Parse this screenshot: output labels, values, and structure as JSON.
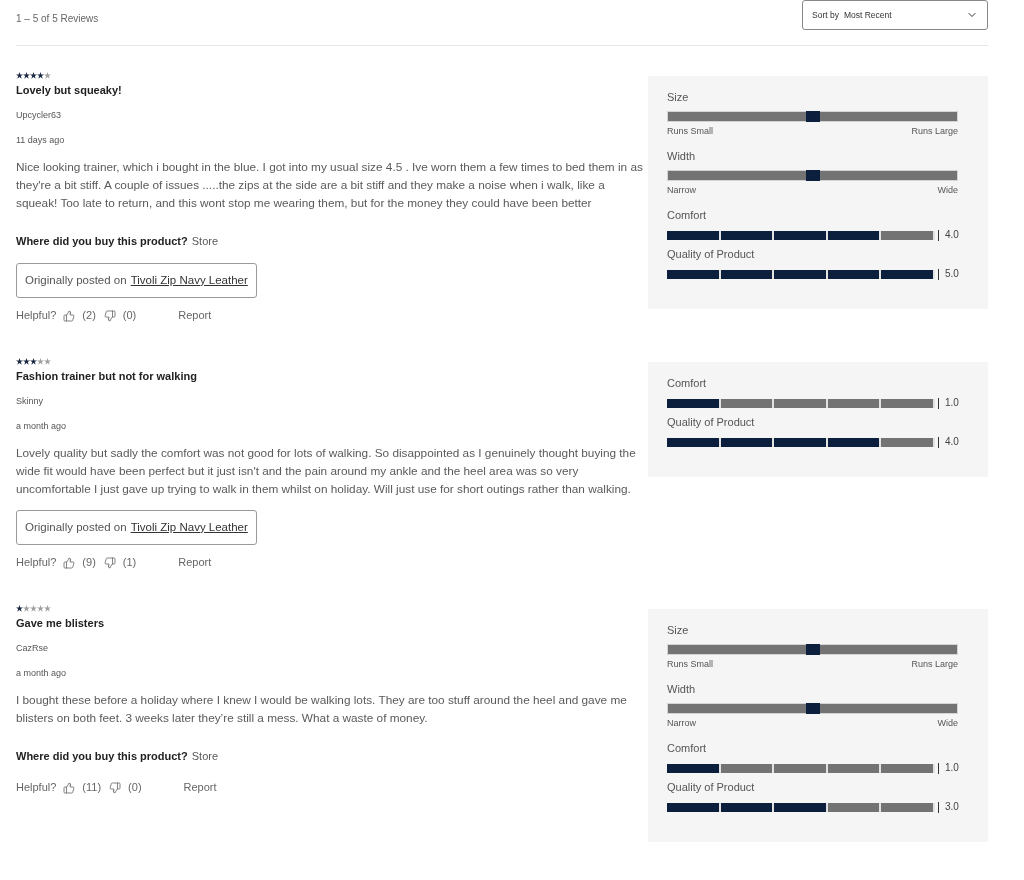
{
  "summary": "1 – 5 of 5 Reviews",
  "sort": {
    "label": "Sort by",
    "value": "Most Recent"
  },
  "reviews": [
    {
      "stars": 4,
      "title": "Lovely but squeaky!",
      "author": "Upcycler63",
      "date": "11 days ago",
      "body": "Nice looking trainer, which i bought in the blue. I got into my usual size 4.5 . Ive worn them a few times to bed them in as they're a bit stiff. A couple of issues .....the zips at the side are a bit stiff and they make a noise when i walk, like a squeak! Too late to return, and this wont stop me wearing them, but for the money they could have been better",
      "purchase": {
        "question": "Where did you buy this product?",
        "answer": "Store"
      },
      "origin": {
        "prefix": "Originally posted on",
        "link": "Tivoli Zip Navy Leather"
      },
      "helpful": {
        "label": "Helpful?",
        "up": "(2)",
        "down": "(0)",
        "report": "Report"
      },
      "ratings": [
        {
          "kind": "scale",
          "label": "Size",
          "level": 0.5,
          "min_label": "Runs Small",
          "max_label": "Runs Large"
        },
        {
          "kind": "scale",
          "label": "Width",
          "level": 0.5,
          "min_label": "Narrow",
          "max_label": "Wide"
        },
        {
          "kind": "segments",
          "label": "Comfort",
          "level": 0.8,
          "reading": "4.0"
        },
        {
          "kind": "segments",
          "label": "Quality of Product",
          "level": 1,
          "reading": "5.0"
        }
      ]
    },
    {
      "stars": 3,
      "title": "Fashion trainer but not for walking",
      "author": "Skinny",
      "date": "a month ago",
      "body": "Lovely quality but sadly the comfort was not good for lots of walking. So disappointed as I genuinely thought buying the wide fit would have been perfect but it just isn't and the pain around my ankle and the heel area was so very uncomfortable I just gave up trying to walk in them whilst on holiday. Will just use for short outings rather than walking.",
      "origin": {
        "prefix": "Originally posted on",
        "link": "Tivoli Zip Navy Leather"
      },
      "helpful": {
        "label": "Helpful?",
        "up": "(9)",
        "down": "(1)",
        "report": "Report"
      },
      "ratings": [
        {
          "kind": "segments",
          "label": "Comfort",
          "level": 0.2,
          "reading": "1.0"
        },
        {
          "kind": "segments",
          "label": "Quality of Product",
          "level": 0.8,
          "reading": "4.0"
        }
      ]
    },
    {
      "stars": 1,
      "title": "Gave me blisters",
      "author": "CazRse",
      "date": "a month ago",
      "body": "I bought these before a holiday where I knew I would be walking lots. They are too stuff around the heel and gave me blisters on both feet. 3 weeks later they’re still a mess. What a waste of money.",
      "purchase": {
        "question": "Where did you buy this product?",
        "answer": "Store"
      },
      "helpful": {
        "label": "Helpful?",
        "up": "(11)",
        "down": "(0)",
        "report": "Report"
      },
      "ratings": [
        {
          "kind": "scale",
          "label": "Size",
          "level": 0.5,
          "min_label": "Runs Small",
          "max_label": "Runs Large"
        },
        {
          "kind": "scale",
          "label": "Width",
          "level": 0.5,
          "min_label": "Narrow",
          "max_label": "Wide"
        },
        {
          "kind": "segments",
          "label": "Comfort",
          "level": 0.2,
          "reading": "1.0"
        },
        {
          "kind": "segments",
          "label": "Quality of Product",
          "level": 0.6,
          "reading": "3.0"
        }
      ]
    }
  ]
}
